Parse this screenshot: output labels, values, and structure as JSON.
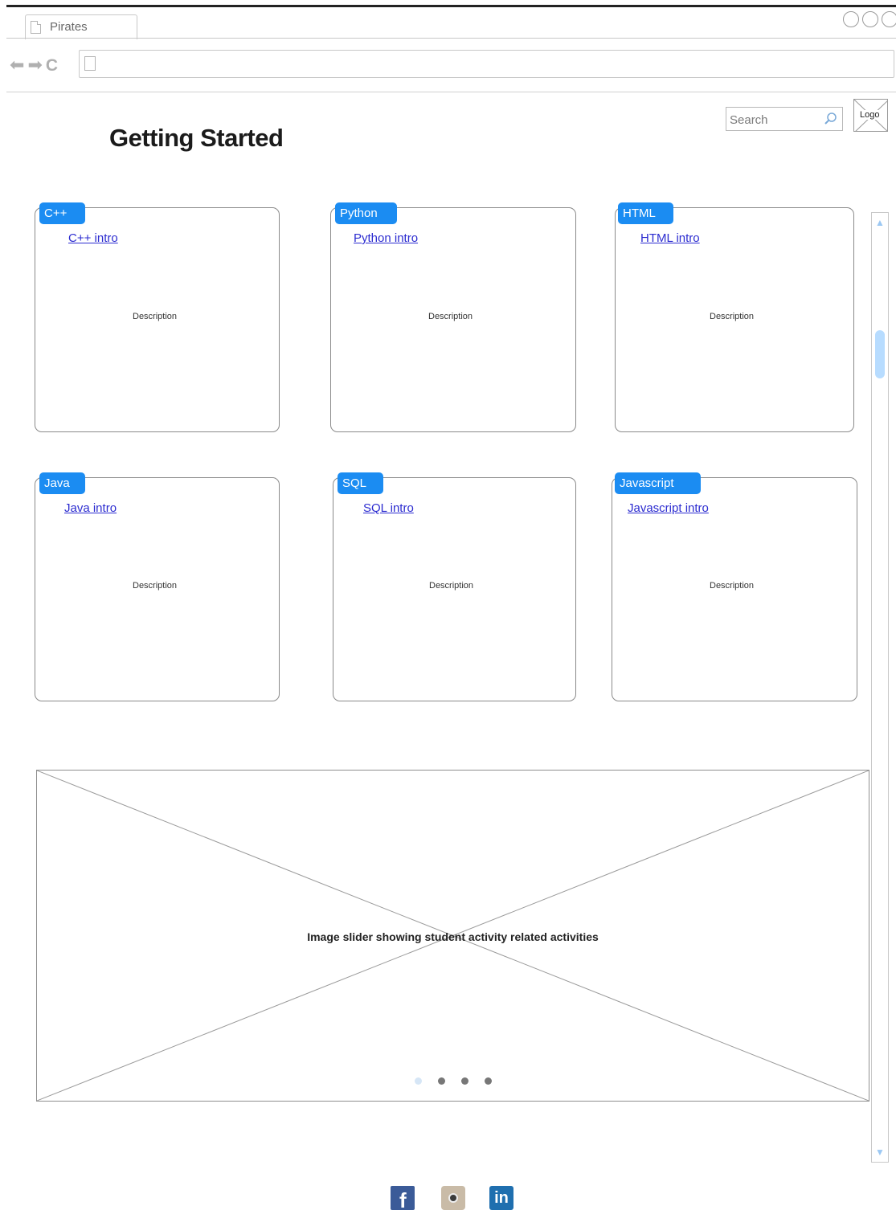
{
  "browser": {
    "tab_title": "Pirates",
    "nav_icons": [
      "back-arrow-icon",
      "forward-arrow-icon",
      "reload-icon",
      "page-icon"
    ],
    "address_url": ""
  },
  "header": {
    "page_title": "Getting Started",
    "search_placeholder": "Search",
    "logo_text": "Logo"
  },
  "cards": [
    {
      "tag": "C++",
      "link": "C++ intro",
      "description": "Description"
    },
    {
      "tag": "Python",
      "link": "Python intro",
      "description": "Description"
    },
    {
      "tag": "HTML",
      "link": "HTML intro",
      "description": "Description"
    },
    {
      "tag": "Java",
      "link": "Java intro",
      "description": "Description"
    },
    {
      "tag": "SQL",
      "link": "SQL intro",
      "description": "Description"
    },
    {
      "tag": "Javascript",
      "link": "Javascript intro",
      "description": "Description"
    }
  ],
  "slider": {
    "caption": "Image slider showing student activity related activities",
    "dot_count": 4,
    "active_dot": 0
  },
  "footer": {
    "social": [
      {
        "name": "facebook-icon",
        "glyph": "f"
      },
      {
        "name": "instagram-icon",
        "glyph": ""
      },
      {
        "name": "linkedin-icon",
        "glyph": "in"
      }
    ]
  },
  "colors": {
    "accent": "#1b8cf2",
    "link": "#2b2bd0",
    "scroll_thumb": "#b7dcff"
  }
}
